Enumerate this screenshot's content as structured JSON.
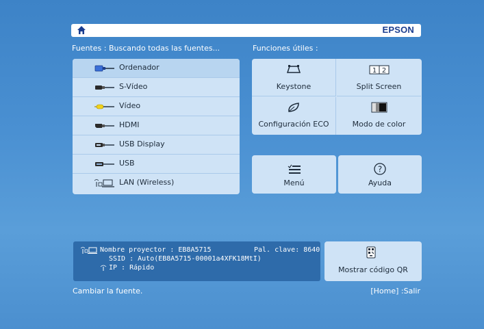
{
  "header": {
    "brand": "EPSON",
    "home_icon": "home-icon"
  },
  "sources": {
    "heading": "Fuentes : Buscando todas las fuentes...",
    "items": [
      {
        "label": "Ordenador",
        "icon": "computer-cable-icon"
      },
      {
        "label": "S-Vídeo",
        "icon": "svideo-cable-icon"
      },
      {
        "label": "Vídeo",
        "icon": "video-cable-icon"
      },
      {
        "label": "HDMI",
        "icon": "hdmi-cable-icon"
      },
      {
        "label": "USB Display",
        "icon": "usb-display-cable-icon"
      },
      {
        "label": "USB",
        "icon": "usb-cable-icon"
      },
      {
        "label": "LAN (Wireless)",
        "icon": "lan-wireless-icon"
      }
    ]
  },
  "functions": {
    "heading": "Funciones útiles :",
    "items": [
      {
        "label": "Keystone",
        "icon": "keystone-icon"
      },
      {
        "label": "Split Screen",
        "icon": "split-screen-icon"
      },
      {
        "label": "Configuración ECO",
        "icon": "eco-leaf-icon"
      },
      {
        "label": "Modo de color",
        "icon": "color-mode-icon"
      },
      {
        "label": "Menú",
        "icon": "menu-list-icon"
      },
      {
        "label": "Ayuda",
        "icon": "help-icon"
      }
    ]
  },
  "network": {
    "projector_name": "Nombre proyector : EB8A5715",
    "password": "Pal. clave: 8640",
    "ssid": "SSID : Auto(EB8A5715-00001a4XFK18MtI)",
    "ip": "IP : Rápido"
  },
  "qr": {
    "label": "Mostrar código QR",
    "icon": "qr-code-icon"
  },
  "footer": {
    "hint": "Cambiar la fuente.",
    "exit": "[Home] :Salir"
  },
  "colors": {
    "background": "#4a90d2",
    "panel": "#cfe3f6",
    "info_panel": "#2e6baa",
    "brand": "#1a3d8f"
  }
}
